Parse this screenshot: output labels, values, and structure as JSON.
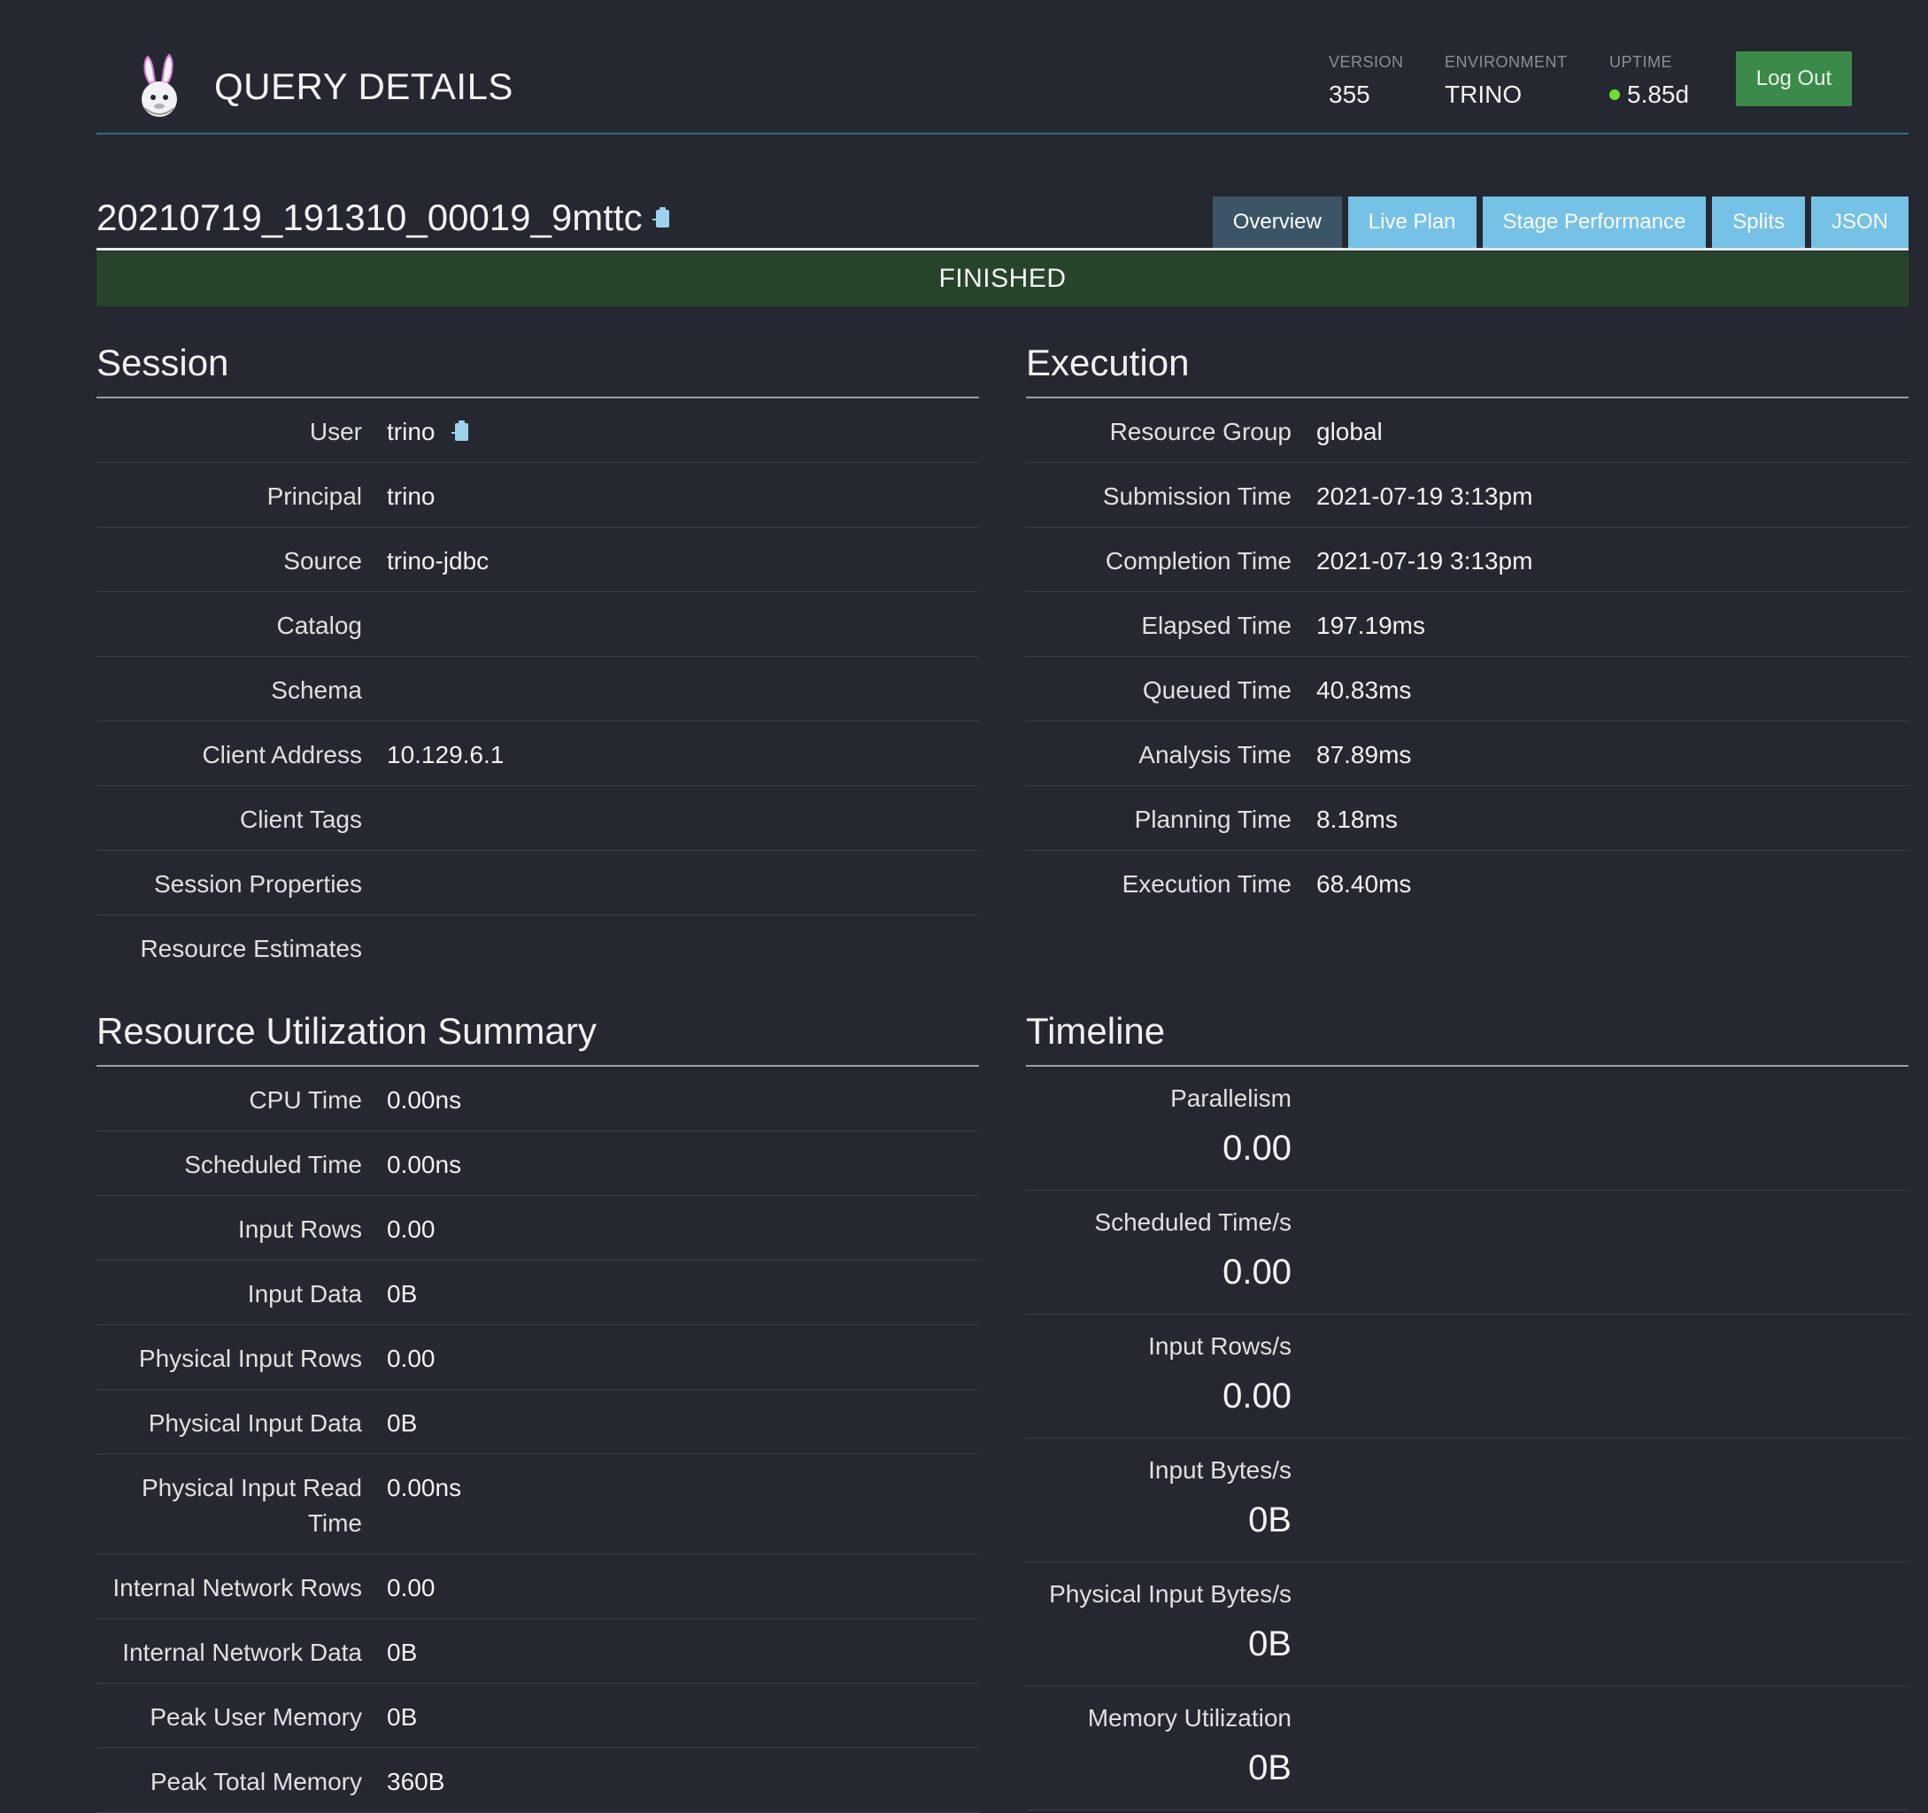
{
  "header": {
    "title": "QUERY DETAILS",
    "version_label": "VERSION",
    "version": "355",
    "environment_label": "ENVIRONMENT",
    "environment": "TRINO",
    "uptime_label": "UPTIME",
    "uptime": "5.85d",
    "logout_label": "Log Out"
  },
  "query": {
    "id": "20210719_191310_00019_9mttc",
    "status": "FINISHED"
  },
  "tabs": [
    "Overview",
    "Live Plan",
    "Stage Performance",
    "Splits",
    "JSON"
  ],
  "session": {
    "title": "Session",
    "rows": [
      {
        "label": "User",
        "value": "trino"
      },
      {
        "label": "Principal",
        "value": "trino"
      },
      {
        "label": "Source",
        "value": "trino-jdbc"
      },
      {
        "label": "Catalog",
        "value": ""
      },
      {
        "label": "Schema",
        "value": ""
      },
      {
        "label": "Client Address",
        "value": "10.129.6.1"
      },
      {
        "label": "Client Tags",
        "value": ""
      },
      {
        "label": "Session Properties",
        "value": ""
      },
      {
        "label": "Resource Estimates",
        "value": ""
      }
    ]
  },
  "execution": {
    "title": "Execution",
    "rows": [
      {
        "label": "Resource Group",
        "value": "global"
      },
      {
        "label": "Submission Time",
        "value": "2021-07-19 3:13pm"
      },
      {
        "label": "Completion Time",
        "value": "2021-07-19 3:13pm"
      },
      {
        "label": "Elapsed Time",
        "value": "197.19ms"
      },
      {
        "label": "Queued Time",
        "value": "40.83ms"
      },
      {
        "label": "Analysis Time",
        "value": "87.89ms"
      },
      {
        "label": "Planning Time",
        "value": "8.18ms"
      },
      {
        "label": "Execution Time",
        "value": "68.40ms"
      }
    ]
  },
  "resource_summary": {
    "title": "Resource Utilization Summary",
    "rows": [
      {
        "label": "CPU Time",
        "value": "0.00ns"
      },
      {
        "label": "Scheduled Time",
        "value": "0.00ns"
      },
      {
        "label": "Input Rows",
        "value": "0.00"
      },
      {
        "label": "Input Data",
        "value": "0B"
      },
      {
        "label": "Physical Input Rows",
        "value": "0.00"
      },
      {
        "label": "Physical Input Data",
        "value": "0B"
      },
      {
        "label": "Physical Input Read Time",
        "value": "0.00ns"
      },
      {
        "label": "Internal Network Rows",
        "value": "0.00"
      },
      {
        "label": "Internal Network Data",
        "value": "0B"
      },
      {
        "label": "Peak User Memory",
        "value": "0B"
      },
      {
        "label": "Peak Total Memory",
        "value": "360B"
      }
    ]
  },
  "timeline": {
    "title": "Timeline",
    "rows": [
      {
        "label": "Parallelism",
        "value": "0.00"
      },
      {
        "label": "Scheduled Time/s",
        "value": "0.00"
      },
      {
        "label": "Input Rows/s",
        "value": "0.00"
      },
      {
        "label": "Input Bytes/s",
        "value": "0B"
      },
      {
        "label": "Physical Input Bytes/s",
        "value": "0B"
      },
      {
        "label": "Memory Utilization",
        "value": "0B"
      }
    ]
  }
}
